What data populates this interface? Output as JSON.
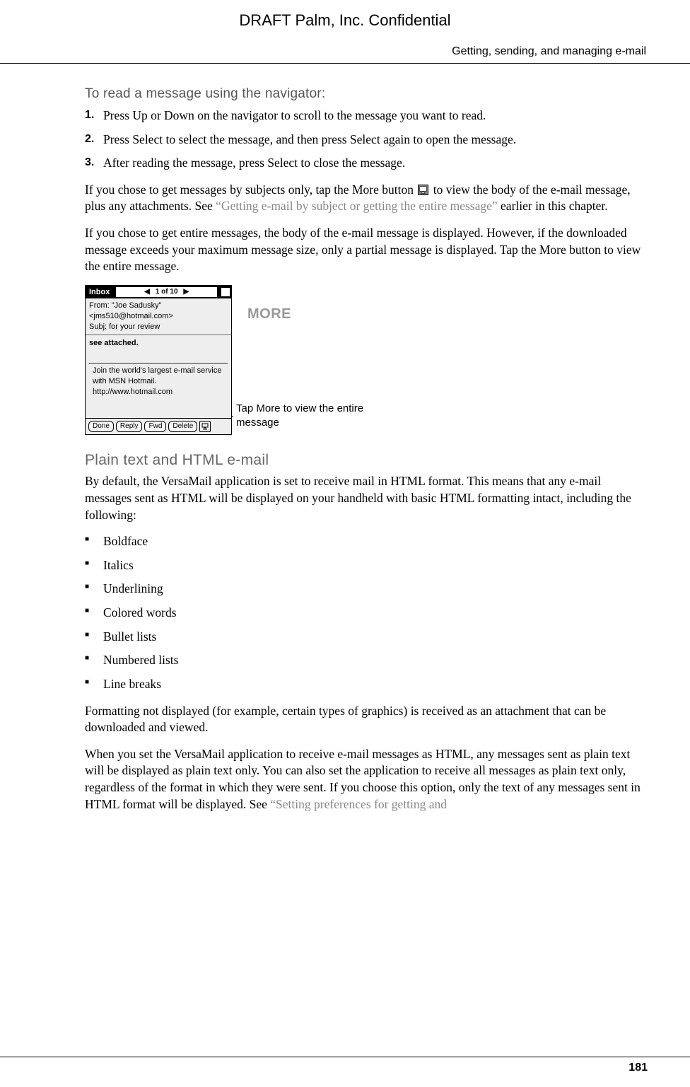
{
  "draft_header": "DRAFT   Palm, Inc. Confidential",
  "running_head": "Getting, sending, and managing e-mail",
  "task_heading": "To read a message using the navigator:",
  "steps": [
    "Press Up or Down on the navigator to scroll to the message you want to read.",
    "Press Select to select the message, and then press Select again to open the message.",
    "After reading the message, press Select to close the message."
  ],
  "para1_a": "If you chose to get messages by subjects only, tap the More button ",
  "para1_b": " to view the body of the e-mail message, plus any attachments. See ",
  "para1_link": "“Getting e-mail by subject or getting the entire message”",
  "para1_c": " earlier in this chapter.",
  "para2": "If you chose to get entire messages, the body of the e-mail message is displayed. However, if the downloaded message exceeds your maximum message size, only a partial message is displayed. Tap the More button to view the entire message.",
  "screenshot": {
    "tab": "Inbox",
    "counter": "1 of 10",
    "from": "From: \"Joe Sadusky\"",
    "email": "<jms510@hotmail.com>",
    "subj": "Subj: for your review",
    "body": "see attached.",
    "sig": "Join the world's largest e-mail service with MSN Hotmail. http://www.hotmail.com",
    "buttons": [
      "Done",
      "Reply",
      "Fwd",
      "Delete"
    ]
  },
  "more_word": "MORE",
  "more_caption": "Tap More to view the entire message",
  "section_heading": "Plain text and HTML e-mail",
  "section_para1": "By default, the VersaMail application is set to receive mail in HTML format. This means that any e-mail messages sent as HTML will be displayed on your handheld with basic HTML formatting intact, including the following:",
  "bullets": [
    "Boldface",
    "Italics",
    "Underlining",
    "Colored words",
    "Bullet lists",
    "Numbered lists",
    "Line breaks"
  ],
  "section_para2": "Formatting not displayed (for example, certain types of graphics) is received as an attachment that can be downloaded and viewed.",
  "section_para3_a": "When you set the VersaMail application to receive e-mail messages as HTML, any messages sent as plain text will be displayed as plain text only. You can also set the application to receive all messages as plain text only, regardless of the format in which they were sent. If you choose this option, only the text of any messages sent in HTML format will be displayed. See ",
  "section_para3_link": "“Setting preferences for getting and",
  "page_number": "181"
}
